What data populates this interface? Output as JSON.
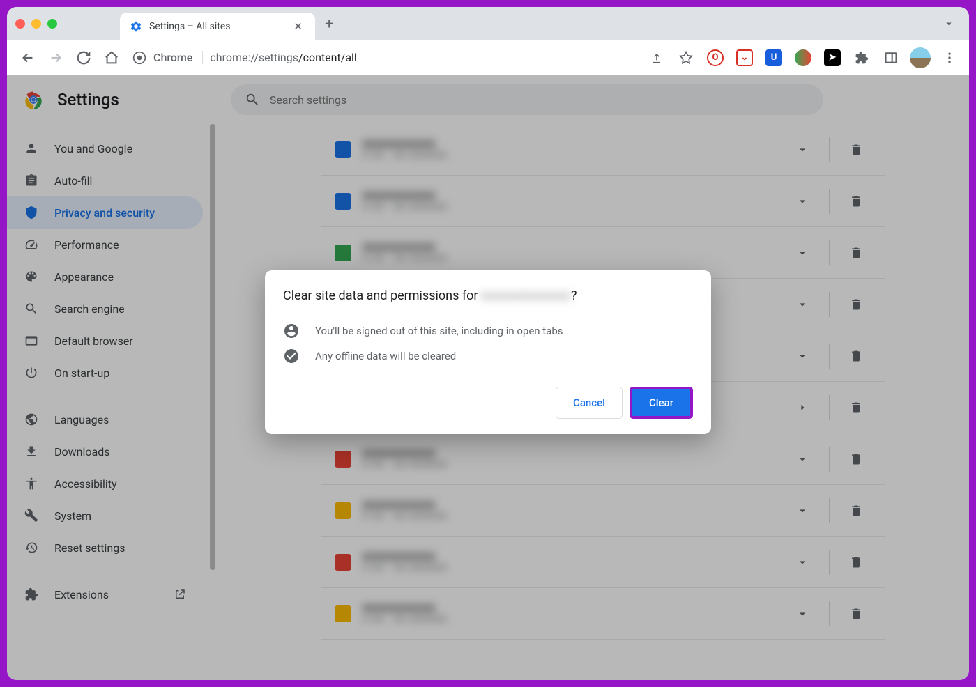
{
  "tab": {
    "title": "Settings – All sites"
  },
  "address": {
    "label": "Chrome",
    "url_prefix": "chrome://settings",
    "url_path": "/content/all"
  },
  "header": {
    "title": "Settings",
    "search_placeholder": "Search settings"
  },
  "sidebar": {
    "items": [
      {
        "label": "You and Google",
        "icon": "person"
      },
      {
        "label": "Auto-fill",
        "icon": "clipboard"
      },
      {
        "label": "Privacy and security",
        "icon": "shield",
        "active": true
      },
      {
        "label": "Performance",
        "icon": "speed"
      },
      {
        "label": "Appearance",
        "icon": "palette"
      },
      {
        "label": "Search engine",
        "icon": "search"
      },
      {
        "label": "Default browser",
        "icon": "browser"
      },
      {
        "label": "On start-up",
        "icon": "power"
      }
    ],
    "items2": [
      {
        "label": "Languages",
        "icon": "globe"
      },
      {
        "label": "Downloads",
        "icon": "download"
      },
      {
        "label": "Accessibility",
        "icon": "accessibility"
      },
      {
        "label": "System",
        "icon": "wrench"
      },
      {
        "label": "Reset settings",
        "icon": "restore"
      }
    ],
    "extensions_label": "Extensions"
  },
  "site_rows": [
    {
      "favicon_color": "#1a73e8"
    },
    {
      "favicon_color": "#1a73e8"
    },
    {
      "favicon_color": "#34a853"
    },
    {
      "favicon_color": "#5f6368"
    },
    {
      "favicon_color": "#5f6368"
    },
    {
      "favicon_color": "#5f6368",
      "arrow": "right"
    },
    {
      "favicon_color": "#ea4335"
    },
    {
      "favicon_color": "#fbbc04"
    },
    {
      "favicon_color": "#ea4335"
    },
    {
      "favicon_color": "#fbbc04"
    }
  ],
  "modal": {
    "title_prefix": "Clear site data and permissions for ",
    "title_blur": "xxxxxxxxxxxxx",
    "title_suffix": "?",
    "line1": "You'll be signed out of this site, including in open tabs",
    "line2": "Any offline data will be cleared",
    "cancel_label": "Cancel",
    "clear_label": "Clear"
  }
}
